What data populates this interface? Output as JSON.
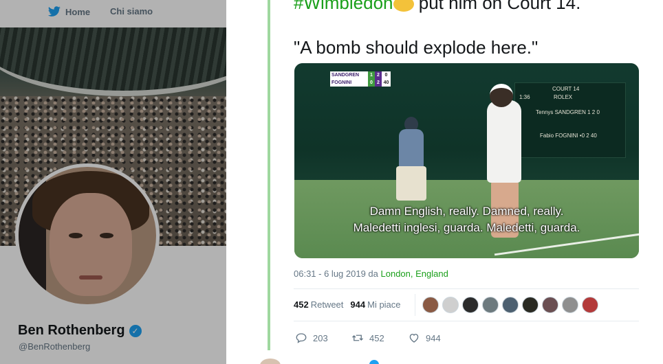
{
  "nav": {
    "home_label": "Home",
    "about_label": "Chi siamo"
  },
  "profile": {
    "name": "Ben Rothenberg",
    "handle": "@BenRothenberg",
    "verified": true
  },
  "tweet": {
    "line1_hashtag": "#Wimbledon",
    "line1_rest": " put him on Court 14.",
    "line2": "\"A bomb should explode here.\"",
    "timestamp": "06:31 - 6 lug 2019 da ",
    "location": "London, England"
  },
  "video": {
    "scorebug": [
      {
        "name": "SANDGREN",
        "g": "1",
        "s": "2",
        "p": "0"
      },
      {
        "name": "FOGNINI",
        "g": "0",
        "s": "2",
        "p": "40"
      }
    ],
    "board": {
      "court": "COURT 14",
      "time": "1:36",
      "rolex": "ROLEX",
      "p1": "Tennys SANDGREN  1 2 0",
      "p2": "Fabio FOGNINI  •0 2 40"
    },
    "subtitle_en": "Damn English, really. Damned, really.",
    "subtitle_it": "Maledetti inglesi, guarda. Maledetti, guarda."
  },
  "stats": {
    "retweets_count": "452",
    "retweets_label": "Retweet",
    "likes_count": "944",
    "likes_label": "Mi piace"
  },
  "actions": {
    "reply_count": "203",
    "retweet_count": "452",
    "like_count": "944"
  },
  "colors": {
    "accent_green": "#1a9f1a",
    "thread_line": "#9fd89f",
    "verified_blue": "#1da1f2"
  }
}
